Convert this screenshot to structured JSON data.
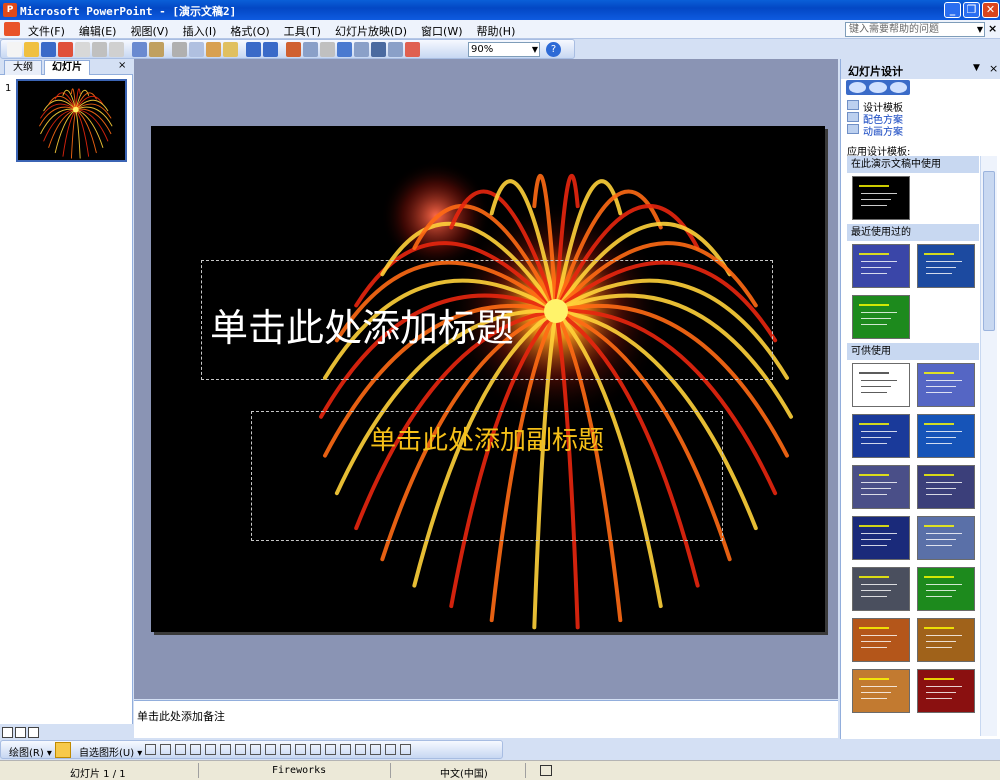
{
  "window": {
    "title": "Microsoft PowerPoint - [演示文稿2]",
    "min_label": "_",
    "restore_label": "❐",
    "close_label": "✕"
  },
  "menu": {
    "items": [
      "文件(F)",
      "编辑(E)",
      "视图(V)",
      "插入(I)",
      "格式(O)",
      "工具(T)",
      "幻灯片放映(D)",
      "窗口(W)",
      "帮助(H)"
    ],
    "help_placeholder": "键入需要帮助的问题",
    "close_label": "×"
  },
  "toolbar": {
    "zoom": "90%"
  },
  "outline_pane": {
    "tab_outline": "大纲",
    "tab_slides": "幻灯片",
    "close_label": "×",
    "slide_number": "1"
  },
  "slide": {
    "title_placeholder": "单击此处添加标题",
    "subtitle_placeholder": "单击此处添加副标题"
  },
  "notes": {
    "placeholder": "单击此处添加备注"
  },
  "task_pane": {
    "title": "幻灯片设计",
    "links": [
      "设计模板",
      "配色方案",
      "动画方案"
    ],
    "apply_label": "应用设计模板:",
    "sections": [
      {
        "name": "在此演示文稿中使用",
        "thumbs": [
          "#000000"
        ]
      },
      {
        "name": "最近使用过的",
        "thumbs": [
          "#3a46a8",
          "#1c4aa0",
          "#1d8a1d"
        ]
      },
      {
        "name": "可供使用",
        "thumbs": [
          "#ffffff",
          "#5566c4",
          "#1a3a9a",
          "#1654b8",
          "#4a4f88",
          "#3b3f7a",
          "#1a2a7a",
          "#5a70a8",
          "#4a4f5e",
          "#1d8a1d",
          "#b4561a",
          "#a0621a",
          "#c27a30",
          "#8a1010"
        ]
      }
    ]
  },
  "draw_toolbar": {
    "draw_label": "绘图(R) ▾",
    "autoshape_label": "自选图形(U) ▾"
  },
  "status": {
    "slide_count": "幻灯片 1 / 1",
    "design": "Fireworks",
    "language": "中文(中国)"
  }
}
